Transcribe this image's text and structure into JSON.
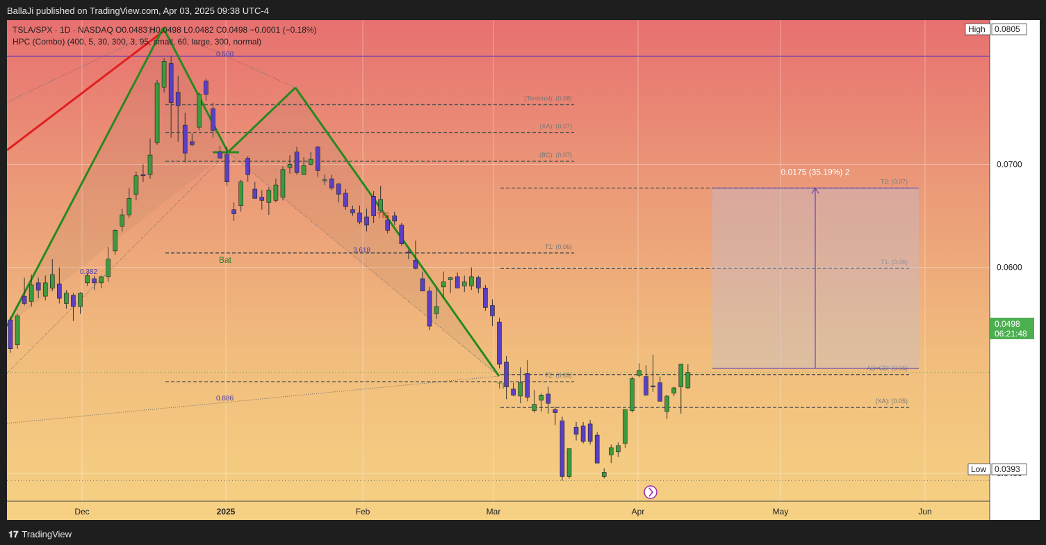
{
  "header": {
    "published": "BallaJi published on TradingView.com, Apr 03, 2025 09:38 UTC-4"
  },
  "legend": {
    "line1": "TSLA/SPX · 1D · NASDAQ  O0.0483  H0.0498  L0.0482  C0.0498  −0.0001 (−0.18%)",
    "line2": "HPC (Combo) (400, 5, 30, 300, 3, 95, small, 60, large, 300, normal)"
  },
  "footer": {
    "brand": "TradingView",
    "mark": "𝟏𝟕"
  },
  "colors": {
    "bull": "#3d9a3d",
    "bear": "#5b3fc4",
    "pattern": "#27891f",
    "red": "#e02020",
    "grid": "#ffffff",
    "level": "#555555",
    "price_badge": "#4caf50",
    "top_line": "#4a2fbf"
  },
  "chart_data": {
    "type": "candlestick",
    "symbol": "TSLA/SPX",
    "interval": "1D",
    "exchange": "NASDAQ",
    "ylim": [
      0.0373,
      0.084
    ],
    "y_ticks": [
      "0.0400",
      "0.0600",
      "0.0700"
    ],
    "x_ticks": [
      "Dec",
      "2025",
      "Feb",
      "Mar",
      "Apr",
      "May",
      "Jun"
    ],
    "high_label": "High",
    "high_value": "0.0805",
    "low_label": "Low",
    "low_value": "0.0393",
    "last_price": "0.0498",
    "countdown": "06:21:48",
    "candles": [
      {
        "o": 0.0549,
        "h": 0.0552,
        "c": 0.0521,
        "l": 0.0517
      },
      {
        "o": 0.0525,
        "h": 0.0555,
        "c": 0.0553,
        "l": 0.0521
      },
      {
        "o": 0.0572,
        "h": 0.059,
        "c": 0.0565,
        "l": 0.0563
      },
      {
        "o": 0.0567,
        "h": 0.0593,
        "c": 0.0583,
        "l": 0.0562
      },
      {
        "o": 0.0585,
        "h": 0.059,
        "c": 0.0578,
        "l": 0.057
      },
      {
        "o": 0.0572,
        "h": 0.0592,
        "c": 0.0585,
        "l": 0.0568
      },
      {
        "o": 0.058,
        "h": 0.0608,
        "c": 0.0593,
        "l": 0.0577
      },
      {
        "o": 0.0584,
        "h": 0.06,
        "c": 0.057,
        "l": 0.0565
      },
      {
        "o": 0.0565,
        "h": 0.0578,
        "c": 0.0575,
        "l": 0.056
      },
      {
        "o": 0.0573,
        "h": 0.0575,
        "c": 0.0562,
        "l": 0.0548
      },
      {
        "o": 0.0562,
        "h": 0.0576,
        "c": 0.0575,
        "l": 0.0555
      },
      {
        "o": 0.0585,
        "h": 0.0595,
        "c": 0.0592,
        "l": 0.0582
      },
      {
        "o": 0.0589,
        "h": 0.0592,
        "c": 0.0585,
        "l": 0.0578
      },
      {
        "o": 0.0585,
        "h": 0.0592,
        "c": 0.0591,
        "l": 0.058
      },
      {
        "o": 0.0591,
        "h": 0.062,
        "c": 0.0608,
        "l": 0.0586
      },
      {
        "o": 0.0616,
        "h": 0.0637,
        "c": 0.0636,
        "l": 0.0612
      },
      {
        "o": 0.064,
        "h": 0.0657,
        "c": 0.0651,
        "l": 0.0635
      },
      {
        "o": 0.0651,
        "h": 0.0677,
        "c": 0.0667,
        "l": 0.0648
      },
      {
        "o": 0.0671,
        "h": 0.0693,
        "c": 0.0689,
        "l": 0.0665
      },
      {
        "o": 0.069,
        "h": 0.07,
        "c": 0.0689,
        "l": 0.0683
      },
      {
        "o": 0.069,
        "h": 0.0725,
        "c": 0.0709,
        "l": 0.0686
      },
      {
        "o": 0.0721,
        "h": 0.0782,
        "c": 0.0779,
        "l": 0.0719
      },
      {
        "o": 0.0775,
        "h": 0.0803,
        "c": 0.08,
        "l": 0.077
      },
      {
        "o": 0.0798,
        "h": 0.0805,
        "c": 0.076,
        "l": 0.0726
      },
      {
        "o": 0.077,
        "h": 0.0786,
        "c": 0.0757,
        "l": 0.0722
      },
      {
        "o": 0.0738,
        "h": 0.075,
        "c": 0.0711,
        "l": 0.0702
      },
      {
        "o": 0.0722,
        "h": 0.073,
        "c": 0.0719,
        "l": 0.0718
      },
      {
        "o": 0.0736,
        "h": 0.077,
        "c": 0.0768,
        "l": 0.0733
      },
      {
        "o": 0.0781,
        "h": 0.0783,
        "c": 0.0768,
        "l": 0.0762
      },
      {
        "o": 0.0754,
        "h": 0.076,
        "c": 0.0733,
        "l": 0.0726
      },
      {
        "o": 0.0712,
        "h": 0.0718,
        "c": 0.0706,
        "l": 0.0707
      },
      {
        "o": 0.071,
        "h": 0.0717,
        "c": 0.0683,
        "l": 0.0679
      },
      {
        "o": 0.0656,
        "h": 0.0663,
        "c": 0.0652,
        "l": 0.0645
      },
      {
        "o": 0.066,
        "h": 0.0685,
        "c": 0.0683,
        "l": 0.0654
      },
      {
        "o": 0.0706,
        "h": 0.0708,
        "c": 0.069,
        "l": 0.0683
      },
      {
        "o": 0.0676,
        "h": 0.0683,
        "c": 0.0667,
        "l": 0.0667
      },
      {
        "o": 0.0668,
        "h": 0.0675,
        "c": 0.0665,
        "l": 0.0656
      },
      {
        "o": 0.0663,
        "h": 0.0678,
        "c": 0.0675,
        "l": 0.0651
      },
      {
        "o": 0.0665,
        "h": 0.0686,
        "c": 0.068,
        "l": 0.0663
      },
      {
        "o": 0.0668,
        "h": 0.0698,
        "c": 0.0695,
        "l": 0.0665
      },
      {
        "o": 0.0697,
        "h": 0.0709,
        "c": 0.07,
        "l": 0.0691
      },
      {
        "o": 0.0712,
        "h": 0.0717,
        "c": 0.0692,
        "l": 0.069
      },
      {
        "o": 0.069,
        "h": 0.0707,
        "c": 0.0699,
        "l": 0.0692
      },
      {
        "o": 0.07,
        "h": 0.0712,
        "c": 0.0705,
        "l": 0.0699
      },
      {
        "o": 0.0717,
        "h": 0.0718,
        "c": 0.0694,
        "l": 0.0688
      },
      {
        "o": 0.0684,
        "h": 0.069,
        "c": 0.0685,
        "l": 0.068
      },
      {
        "o": 0.0686,
        "h": 0.069,
        "c": 0.0677,
        "l": 0.0675
      },
      {
        "o": 0.0681,
        "h": 0.0682,
        "c": 0.0671,
        "l": 0.0663
      },
      {
        "o": 0.0672,
        "h": 0.0676,
        "c": 0.0659,
        "l": 0.0656
      },
      {
        "o": 0.0656,
        "h": 0.066,
        "c": 0.0653,
        "l": 0.065
      },
      {
        "o": 0.0653,
        "h": 0.066,
        "c": 0.0644,
        "l": 0.0642
      },
      {
        "o": 0.0649,
        "h": 0.0657,
        "c": 0.0641,
        "l": 0.0635
      },
      {
        "o": 0.0669,
        "h": 0.0674,
        "c": 0.065,
        "l": 0.0643
      },
      {
        "o": 0.0655,
        "h": 0.0679,
        "c": 0.0666,
        "l": 0.0653
      },
      {
        "o": 0.0646,
        "h": 0.065,
        "c": 0.0636,
        "l": 0.0633
      },
      {
        "o": 0.065,
        "h": 0.0654,
        "c": 0.0645,
        "l": 0.0641
      },
      {
        "o": 0.0641,
        "h": 0.0643,
        "c": 0.0623,
        "l": 0.0621
      },
      {
        "o": 0.0615,
        "h": 0.0617,
        "c": 0.0614,
        "l": 0.0608
      },
      {
        "o": 0.0607,
        "h": 0.0626,
        "c": 0.0599,
        "l": 0.0598
      },
      {
        "o": 0.0589,
        "h": 0.0596,
        "c": 0.0577,
        "l": 0.0577
      },
      {
        "o": 0.0577,
        "h": 0.0581,
        "c": 0.0543,
        "l": 0.0539
      },
      {
        "o": 0.0555,
        "h": 0.058,
        "c": 0.0562,
        "l": 0.055
      },
      {
        "o": 0.0581,
        "h": 0.0596,
        "c": 0.0586,
        "l": 0.057
      },
      {
        "o": 0.0588,
        "h": 0.0591,
        "c": 0.059,
        "l": 0.0575
      },
      {
        "o": 0.0591,
        "h": 0.0595,
        "c": 0.058,
        "l": 0.0584
      },
      {
        "o": 0.0582,
        "h": 0.0592,
        "c": 0.0586,
        "l": 0.0576
      },
      {
        "o": 0.0582,
        "h": 0.06,
        "c": 0.0591,
        "l": 0.0578
      },
      {
        "o": 0.059,
        "h": 0.0592,
        "c": 0.058,
        "l": 0.0575
      },
      {
        "o": 0.058,
        "h": 0.0583,
        "c": 0.0561,
        "l": 0.0558
      },
      {
        "o": 0.0563,
        "h": 0.0569,
        "c": 0.0553,
        "l": 0.0543
      },
      {
        "o": 0.0547,
        "h": 0.0551,
        "c": 0.0506,
        "l": 0.0502
      },
      {
        "o": 0.0508,
        "h": 0.0514,
        "c": 0.0484,
        "l": 0.0472
      },
      {
        "o": 0.0482,
        "h": 0.0488,
        "c": 0.0476,
        "l": 0.0475
      },
      {
        "o": 0.0475,
        "h": 0.0503,
        "c": 0.0488,
        "l": 0.0468
      },
      {
        "o": 0.0497,
        "h": 0.051,
        "c": 0.0474,
        "l": 0.047
      },
      {
        "o": 0.0461,
        "h": 0.0481,
        "c": 0.0467,
        "l": 0.0459
      },
      {
        "o": 0.0471,
        "h": 0.0478,
        "c": 0.0476,
        "l": 0.046
      },
      {
        "o": 0.0477,
        "h": 0.0484,
        "c": 0.0468,
        "l": 0.0458
      },
      {
        "o": 0.0462,
        "h": 0.0465,
        "c": 0.0459,
        "l": 0.0447
      },
      {
        "o": 0.0451,
        "h": 0.0455,
        "c": 0.0397,
        "l": 0.0393
      },
      {
        "o": 0.0397,
        "h": 0.0424,
        "c": 0.0424,
        "l": 0.0395
      },
      {
        "o": 0.0445,
        "h": 0.045,
        "c": 0.0438,
        "l": 0.0432
      },
      {
        "o": 0.0446,
        "h": 0.045,
        "c": 0.0431,
        "l": 0.0429
      },
      {
        "o": 0.0448,
        "h": 0.0452,
        "c": 0.0431,
        "l": 0.0428
      },
      {
        "o": 0.0437,
        "h": 0.044,
        "c": 0.041,
        "l": 0.0422
      },
      {
        "o": 0.0397,
        "h": 0.0405,
        "c": 0.0401,
        "l": 0.0395
      },
      {
        "o": 0.0418,
        "h": 0.0428,
        "c": 0.0425,
        "l": 0.041
      },
      {
        "o": 0.0421,
        "h": 0.043,
        "c": 0.0427,
        "l": 0.0416
      },
      {
        "o": 0.0429,
        "h": 0.0462,
        "c": 0.0462,
        "l": 0.0425
      },
      {
        "o": 0.0461,
        "h": 0.0494,
        "c": 0.0492,
        "l": 0.0459
      },
      {
        "o": 0.0495,
        "h": 0.0507,
        "c": 0.05,
        "l": 0.0493
      },
      {
        "o": 0.0494,
        "h": 0.0505,
        "c": 0.0476,
        "l": 0.0483
      },
      {
        "o": 0.0485,
        "h": 0.0515,
        "c": 0.0484,
        "l": 0.0479
      },
      {
        "o": 0.0488,
        "h": 0.0494,
        "c": 0.047,
        "l": 0.0473
      },
      {
        "o": 0.046,
        "h": 0.0476,
        "c": 0.0475,
        "l": 0.0453
      },
      {
        "o": 0.0478,
        "h": 0.0484,
        "c": 0.0483,
        "l": 0.0475
      },
      {
        "o": 0.0484,
        "h": 0.0505,
        "c": 0.0506,
        "l": 0.0458
      },
      {
        "o": 0.0483,
        "h": 0.0506,
        "c": 0.0498,
        "l": 0.0482
      }
    ],
    "harmonic_pattern": {
      "name": "Bat",
      "points": [
        {
          "d": "Nov 12",
          "v": 0.0551
        },
        {
          "d": "Dec 17",
          "v": 0.0805
        },
        {
          "d": "Jan 6",
          "v": 0.0663
        },
        {
          "d": "Jan 16",
          "v": 0.0729
        },
        {
          "d": "Feb 28",
          "v": 0.0465
        }
      ],
      "labels": {
        "top": "TI",
        "tis": "TIS",
        "bottom": "TI"
      }
    },
    "ratios": [
      "0.500",
      "0.382",
      "3.618",
      "0.886"
    ],
    "levels_left": [
      {
        "label": "(Terminal): (0.08)",
        "v": 0.0758
      },
      {
        "label": "(XA): (0.07)",
        "v": 0.0731
      },
      {
        "label": "(BC): (0.07)",
        "v": 0.0703
      },
      {
        "label": "T1: (0.06)",
        "v": 0.0614
      },
      {
        "label": "T2: (0.05)",
        "v": 0.0489
      }
    ],
    "levels_right": [
      {
        "label": "T2: (0.07)",
        "v": 0.0677
      },
      {
        "label": "T1: (0.06)",
        "v": 0.0599
      },
      {
        "label": "AB=CD: (0.05)",
        "v": 0.0496
      },
      {
        "label": "(XA): (0.05)",
        "v": 0.0464
      }
    ],
    "measure": {
      "label": "0.0175 (35.19%) 2",
      "from": 0.0502,
      "to": 0.0677
    }
  }
}
